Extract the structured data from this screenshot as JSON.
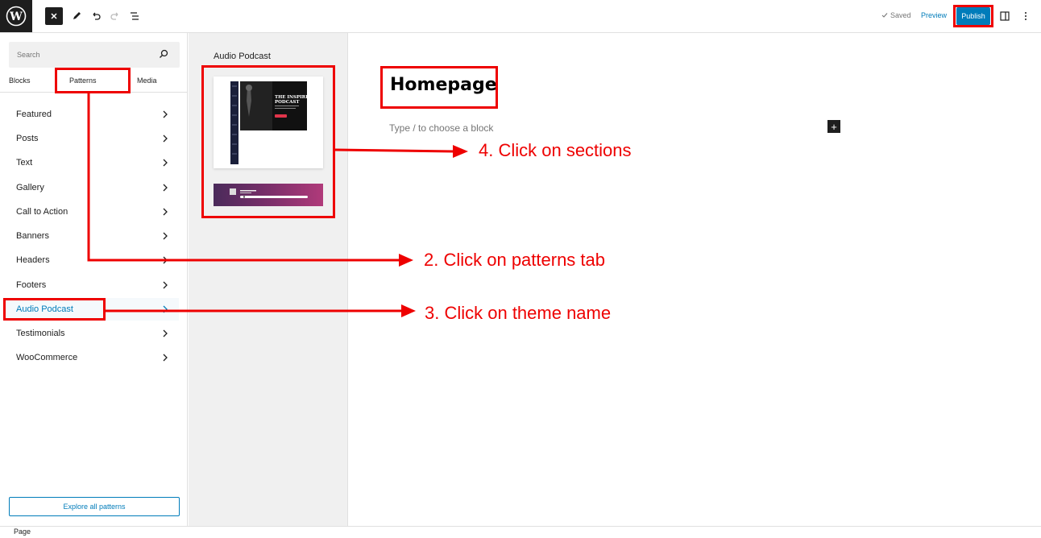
{
  "topbar": {
    "saved_label": "Saved",
    "preview_label": "Preview",
    "publish_label": "Publish"
  },
  "inserter": {
    "search_placeholder": "Search",
    "tabs": [
      "Blocks",
      "Patterns",
      "Media"
    ],
    "active_tab": "Patterns",
    "categories": [
      "Featured",
      "Posts",
      "Text",
      "Gallery",
      "Call to Action",
      "Banners",
      "Headers",
      "Footers",
      "Audio Podcast",
      "Testimonials",
      "WooCommerce"
    ],
    "active_category": "Audio Podcast",
    "explore_label": "Explore all patterns"
  },
  "patterns": {
    "title": "Audio Podcast",
    "preview_headline": "THE INSPIRE PODCAST"
  },
  "canvas": {
    "page_title": "Homepage",
    "placeholder": "Type / to choose a block"
  },
  "footer": {
    "breadcrumb": "Page"
  },
  "annotations": {
    "step2": "2. Click on patterns tab",
    "step3": "3. Click on theme name",
    "step4": "4. Click on sections"
  },
  "colors": {
    "accent": "#007cba",
    "annotation": "#e00000",
    "dark": "#1e1e1e"
  }
}
